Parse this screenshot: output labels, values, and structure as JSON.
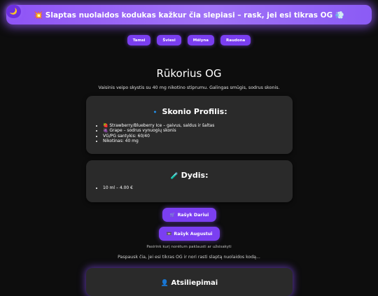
{
  "theme_toggle": {
    "icon": "moon-icon",
    "glyph": "🌙"
  },
  "banner": {
    "text": "💥 Slaptas nuolaidos kodukas kažkur čia slepiasi – rask, jei esi tikras OG 💨"
  },
  "themes": [
    "Tamsi",
    "Šviesi",
    "Mėlyna",
    "Raudona"
  ],
  "product": {
    "title": "Rūkorius OG",
    "description": "Vaisinis veipo skystis su 40 mg nikotino stiprumu. Galingas smūgis, sodrus skonis."
  },
  "flavor_card": {
    "icon": "🔹",
    "title": "Skonio Profilis:",
    "items": [
      "🍓 Strawberry/Blueberry Ice – gaivus, saldus ir šaltas",
      "🍇 Grape – sodrus vynuogių skonis",
      "VG/PG santykis: 60/40",
      "Nikotinas: 40 mg"
    ]
  },
  "size_card": {
    "icon": "🧪",
    "title": "Dydis:",
    "items": [
      "10 ml – 4.00 €"
    ]
  },
  "order": {
    "btn1_icon": "🛒",
    "btn1_label": "Rašyk Dariui",
    "btn2_icon": "📼",
    "btn2_label": "Rašyk Augustui",
    "hint": "Pasirink kurį norėtum paklausti ar užsisakyti"
  },
  "secret_text": "Paspausk čia, jei esi tikras OG ir nori rasti slaptą nuolaidos kodą...",
  "reviews_card": {
    "icon": "👤",
    "title": "Atsiliepimai"
  },
  "colors": {
    "accent": "#7b3ff1",
    "banner": "#9a66f6",
    "card": "#2a2a2a",
    "background": "#0d0d0d"
  }
}
